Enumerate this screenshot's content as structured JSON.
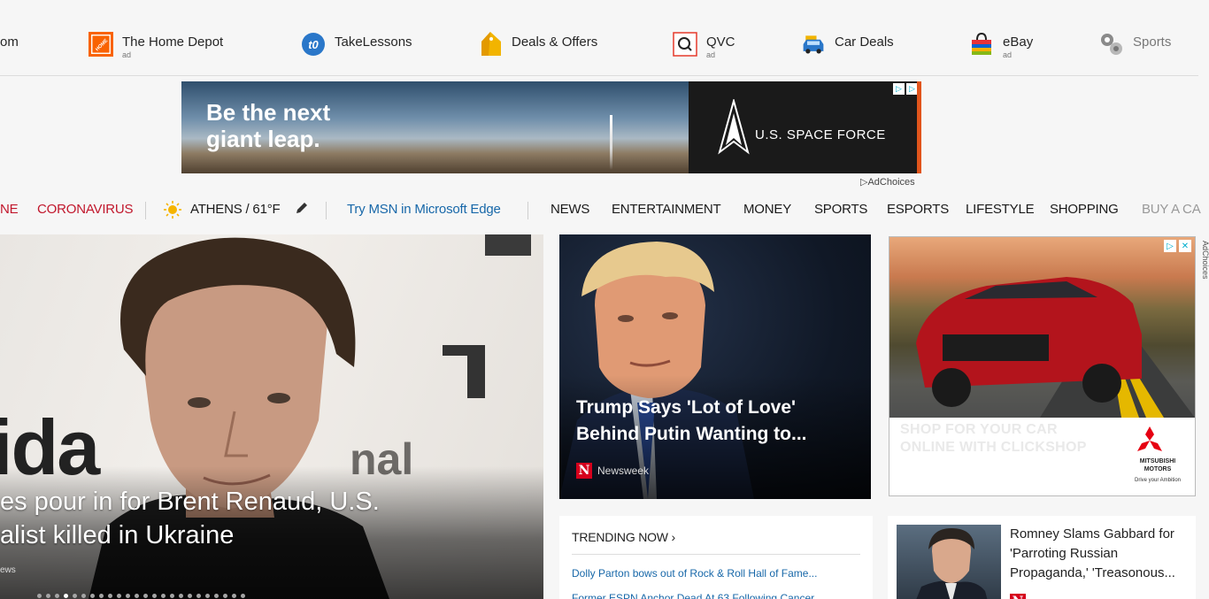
{
  "quicklinks": [
    {
      "label": "om",
      "ad": "",
      "icon": "partial-icon"
    },
    {
      "label": "The Home Depot",
      "ad": "ad",
      "icon": "home-depot-icon"
    },
    {
      "label": "TakeLessons",
      "ad": "",
      "icon": "takelessons-icon"
    },
    {
      "label": "Deals & Offers",
      "ad": "",
      "icon": "tag-icon"
    },
    {
      "label": "QVC",
      "ad": "ad",
      "icon": "qvc-icon"
    },
    {
      "label": "Car Deals",
      "ad": "",
      "icon": "car-icon"
    },
    {
      "label": "eBay",
      "ad": "ad",
      "icon": "shopping-bag-icon"
    },
    {
      "label": "Sports",
      "ad": "",
      "icon": "sports-icon"
    }
  ],
  "banner": {
    "headline": "Be the next\ngiant leap.",
    "brand": "U.S. SPACE FORCE",
    "adchoices": "AdChoices"
  },
  "nav": {
    "partial_left": "NE",
    "coronavirus": "CORONAVIRUS",
    "weather": "ATHENS / 61°F",
    "edge_link": "Try MSN in Microsoft Edge",
    "items": [
      "NEWS",
      "ENTERTAINMENT",
      "MONEY",
      "SPORTS",
      "ESPORTS",
      "LIFESTYLE",
      "SHOPPING"
    ],
    "partial_right": "BUY A CA"
  },
  "hero": {
    "background_text": "ida",
    "background_text2": "nal",
    "title": "es pour in for Brent Renaud, U.S.\nalist killed in Ukraine",
    "source": "ews",
    "dots_count": 24,
    "active_dot": 3
  },
  "story2": {
    "title": "Trump Says 'Lot of Love'\nBehind Putin Wanting to...",
    "source": "Newsweek",
    "source_logo": "N"
  },
  "ad": {
    "tagline": "SHOP FOR YOUR CAR\nONLINE WITH CLICKSHOP",
    "brand": "MITSUBISHI\nMOTORS",
    "brand_tag": "Drive your Ambition",
    "side_label": "AdChoices"
  },
  "trending": {
    "heading": "TRENDING NOW ›",
    "items": [
      "Dolly Parton bows out of Rock & Roll Hall of Fame...",
      "Former ESPN Anchor Dead At 63 Following Cancer..."
    ]
  },
  "story3": {
    "title": "Romney Slams Gabbard for\n'Parroting Russian\nPropaganda,' 'Treasonous..."
  }
}
